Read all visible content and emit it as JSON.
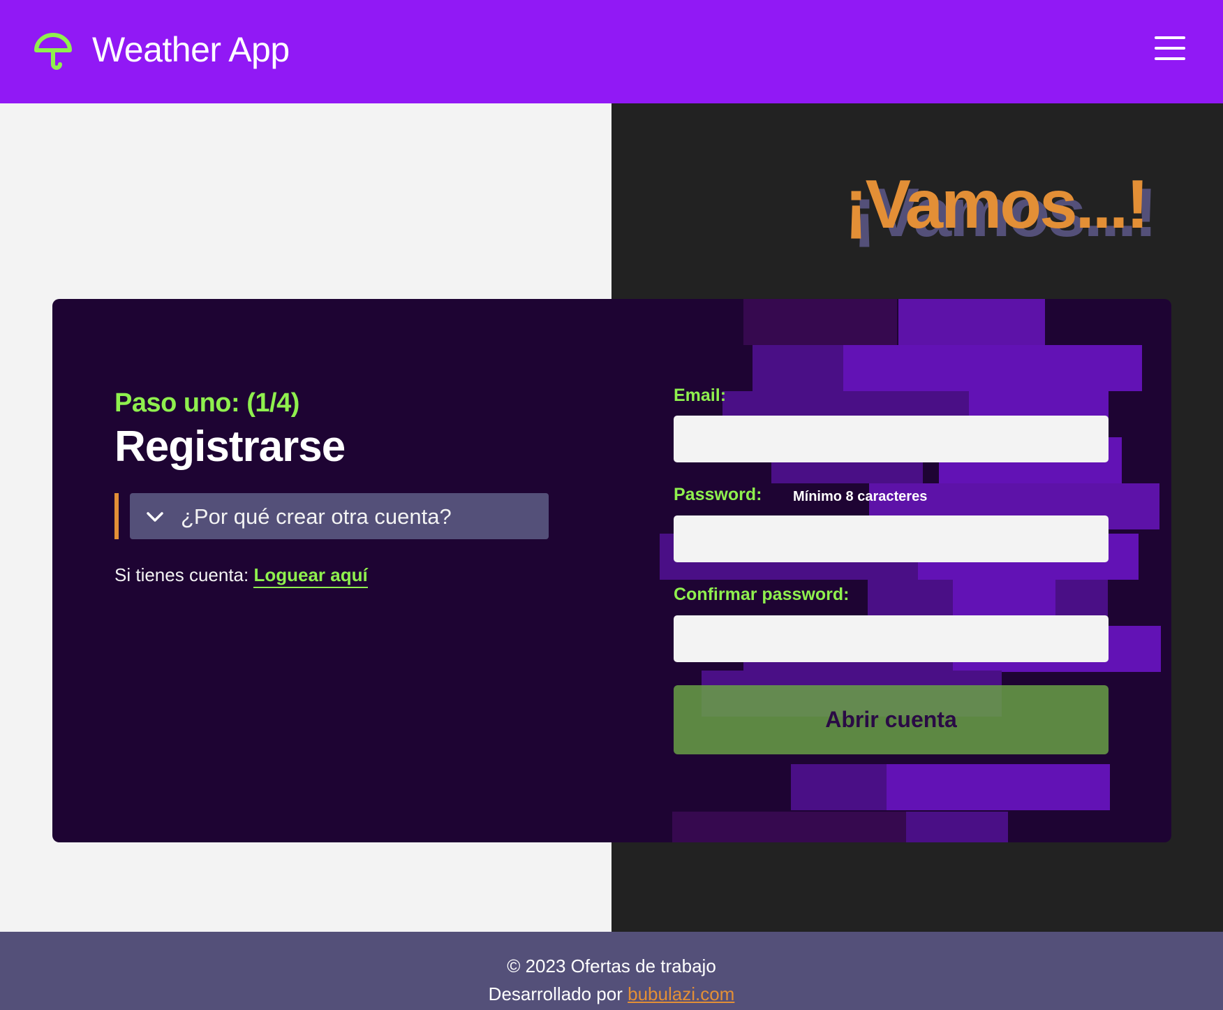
{
  "header": {
    "app_title": "Weather App",
    "logo_icon": "umbrella-icon",
    "menu_icon": "hamburger-menu-icon"
  },
  "hero": {
    "headline": "¡Vamos...!"
  },
  "register": {
    "step": "Paso uno: (1/4)",
    "title": "Registrarse",
    "accordion_label": "¿Por qué crear otra cuenta?",
    "login_prompt": "Si tienes cuenta:",
    "login_link": "Loguear aquí"
  },
  "form": {
    "email_label": "Email:",
    "email_value": "",
    "password_label": "Password:",
    "password_hint": "Mínimo 8 caracteres",
    "password_value": "",
    "confirm_label": "Confirmar password:",
    "confirm_value": "",
    "submit_label": "Abrir cuenta"
  },
  "footer": {
    "copyright": "© 2023 Ofertas de trabajo",
    "developed_by": "Desarrollado por",
    "dev_link": "bubulazi.com"
  },
  "colors": {
    "header": "#9119f5",
    "accent_green": "#8ff04e",
    "accent_orange": "#e38f36",
    "card": "#1e0433",
    "footer": "#545079"
  }
}
